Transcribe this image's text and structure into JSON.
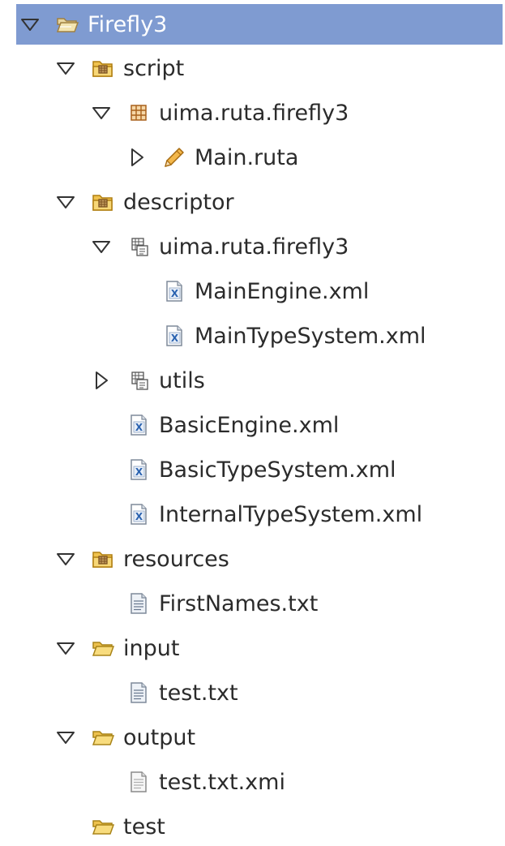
{
  "tree": [
    {
      "label": "Firefly3",
      "icon": "open-project-folder-icon",
      "twisty": "expanded",
      "selected": true
    },
    {
      "label": "script",
      "icon": "source-folder-icon",
      "twisty": "expanded"
    },
    {
      "label": "uima.ruta.firefly3",
      "icon": "package-icon",
      "twisty": "expanded"
    },
    {
      "label": "Main.ruta",
      "icon": "ruta-script-icon",
      "twisty": "collapsed"
    },
    {
      "label": "descriptor",
      "icon": "source-folder-icon",
      "twisty": "expanded"
    },
    {
      "label": "uima.ruta.firefly3",
      "icon": "descriptor-package-icon",
      "twisty": "expanded"
    },
    {
      "label": "MainEngine.xml",
      "icon": "xml-file-icon",
      "twisty": "none"
    },
    {
      "label": "MainTypeSystem.xml",
      "icon": "xml-file-icon",
      "twisty": "none"
    },
    {
      "label": "utils",
      "icon": "descriptor-package-icon",
      "twisty": "collapsed"
    },
    {
      "label": "BasicEngine.xml",
      "icon": "xml-file-icon",
      "twisty": "none"
    },
    {
      "label": "BasicTypeSystem.xml",
      "icon": "xml-file-icon",
      "twisty": "none"
    },
    {
      "label": "InternalTypeSystem.xml",
      "icon": "xml-file-icon",
      "twisty": "none"
    },
    {
      "label": "resources",
      "icon": "source-folder-icon",
      "twisty": "expanded"
    },
    {
      "label": "FirstNames.txt",
      "icon": "text-file-icon",
      "twisty": "none"
    },
    {
      "label": "input",
      "icon": "open-folder-icon",
      "twisty": "expanded"
    },
    {
      "label": "test.txt",
      "icon": "text-file-icon",
      "twisty": "none"
    },
    {
      "label": "output",
      "icon": "open-folder-icon",
      "twisty": "expanded"
    },
    {
      "label": "test.txt.xmi",
      "icon": "generic-file-icon",
      "twisty": "none"
    },
    {
      "label": "test",
      "icon": "open-folder-icon",
      "twisty": "none"
    }
  ]
}
